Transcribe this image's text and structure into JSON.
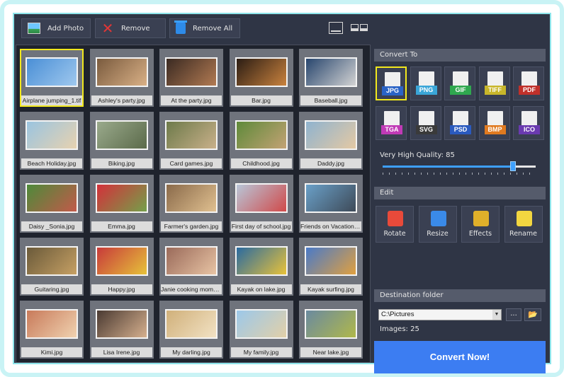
{
  "toolbar": {
    "add_photo": "Add Photo",
    "remove": "Remove",
    "remove_all": "Remove All"
  },
  "gallery": {
    "selected_index": 0,
    "items": [
      {
        "name": "Airplane jumping_1.tif",
        "colors": [
          "#4a8fd6",
          "#9fc8ee"
        ]
      },
      {
        "name": "Ashley's party.jpg",
        "colors": [
          "#7a5b3e",
          "#d9b086"
        ]
      },
      {
        "name": "At the party.jpg",
        "colors": [
          "#3a2a22",
          "#b27a52"
        ]
      },
      {
        "name": "Bar.jpg",
        "colors": [
          "#2b1d14",
          "#c9823e"
        ]
      },
      {
        "name": "Baseball.jpg",
        "colors": [
          "#28466e",
          "#d3d3d3"
        ]
      },
      {
        "name": "Beach Holiday.jpg",
        "colors": [
          "#9ac4e0",
          "#e7d2b0"
        ]
      },
      {
        "name": "Biking.jpg",
        "colors": [
          "#9aaa8c",
          "#5b6a4a"
        ]
      },
      {
        "name": "Card games.jpg",
        "colors": [
          "#6d7a4a",
          "#c9b08a"
        ]
      },
      {
        "name": "Childhood.jpg",
        "colors": [
          "#5e8a3a",
          "#c3a274"
        ]
      },
      {
        "name": "Daddy.jpg",
        "colors": [
          "#8fb3cf",
          "#e4c9a4"
        ]
      },
      {
        "name": "Daisy _Sonia.jpg",
        "colors": [
          "#4d8a3a",
          "#c25a4a"
        ]
      },
      {
        "name": "Emma.jpg",
        "colors": [
          "#d4303a",
          "#74a04a"
        ]
      },
      {
        "name": "Farmer's garden.jpg",
        "colors": [
          "#8a6a4a",
          "#e0c090"
        ]
      },
      {
        "name": "First day of school.jpg",
        "colors": [
          "#b8c6d8",
          "#d04a4a"
        ]
      },
      {
        "name": "Friends on Vacation.jpg",
        "colors": [
          "#6aa0c8",
          "#3e4a58"
        ]
      },
      {
        "name": "Guitaring.jpg",
        "colors": [
          "#6a5a3a",
          "#c6a064"
        ]
      },
      {
        "name": "Happy.jpg",
        "colors": [
          "#c83a3a",
          "#e6c23a"
        ]
      },
      {
        "name": "Janie cooking moments.jpg",
        "colors": [
          "#9a6a5a",
          "#e8c4a4"
        ]
      },
      {
        "name": "Kayak on lake.jpg",
        "colors": [
          "#2a6aa0",
          "#e8c23a"
        ]
      },
      {
        "name": "Kayak surfing.jpg",
        "colors": [
          "#4a7ac8",
          "#e0a040"
        ]
      },
      {
        "name": "Kimi.jpg",
        "colors": [
          "#c87a5a",
          "#f0d2b0"
        ]
      },
      {
        "name": "Lisa Irene.jpg",
        "colors": [
          "#4a3a32",
          "#d6b08e"
        ]
      },
      {
        "name": "My darling.jpg",
        "colors": [
          "#d0b07a",
          "#f2e2c4"
        ]
      },
      {
        "name": "My family.jpg",
        "colors": [
          "#9cc8ea",
          "#e2d0a8"
        ]
      },
      {
        "name": "Near lake.jpg",
        "colors": [
          "#6a8aa0",
          "#b0b84a"
        ]
      }
    ]
  },
  "panel": {
    "convert_to": "Convert To",
    "formats": [
      {
        "label": "JPG",
        "color": "#2a63c6"
      },
      {
        "label": "PNG",
        "color": "#3aa6d8"
      },
      {
        "label": "GIF",
        "color": "#2fa84f"
      },
      {
        "label": "TIFF",
        "color": "#c8b62a"
      },
      {
        "label": "PDF",
        "color": "#c0302a"
      },
      {
        "label": "TGA",
        "color": "#c03ab6"
      },
      {
        "label": "SVG",
        "color": "#3a3a3a"
      },
      {
        "label": "PSD",
        "color": "#2a5abf"
      },
      {
        "label": "BMP",
        "color": "#e07a20"
      },
      {
        "label": "ICO",
        "color": "#6a3ab0"
      }
    ],
    "selected_format": "JPG",
    "quality_label": "Very High Quality: 85",
    "quality_value": 85,
    "edit": "Edit",
    "edit_buttons": [
      {
        "label": "Rotate",
        "icon": "rotate-icon"
      },
      {
        "label": "Resize",
        "icon": "resize-icon"
      },
      {
        "label": "Effects",
        "icon": "magic-wand-icon"
      },
      {
        "label": "Rename",
        "icon": "rename-icon"
      }
    ],
    "destination_folder": "Destination folder",
    "destination_path": "C:\\Pictures",
    "browse_label": "...",
    "images_count": "Images: 25",
    "convert_now": "Convert Now!"
  }
}
